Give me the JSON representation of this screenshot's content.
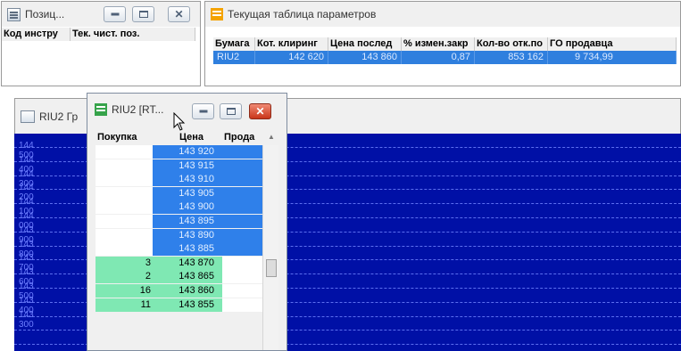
{
  "positions_window": {
    "title": "Позиц...",
    "columns": [
      "Код инстру",
      "Тек. чист. поз."
    ]
  },
  "params_window": {
    "title": "Текущая таблица параметров",
    "columns": [
      "Бумага",
      "Кот. клиринг",
      "Цена послед",
      "% измен.закр",
      "Кол-во отк.по",
      "ГО продавца"
    ],
    "rows": [
      [
        "RIU2",
        "142 620",
        "143 860",
        "0,87",
        "853 162",
        "9 734,99"
      ]
    ]
  },
  "chart_window": {
    "title": "RIU2 Гр",
    "y_labels": [
      "144 500",
      "144 400",
      "144 300",
      "144 200",
      "144 100",
      "144 000",
      "143 900",
      "143 800",
      "143 700",
      "143 600",
      "143 500",
      "143 400",
      "143 300"
    ]
  },
  "orderbook_window": {
    "title": "RIU2 [RT...",
    "columns": [
      "Покупка",
      "Цена",
      "Прода"
    ],
    "scroll_up_glyph": "▲",
    "rows": [
      {
        "bid": "",
        "price": "143 920",
        "type": "ask"
      },
      {
        "bid": "",
        "price": "143 915",
        "type": "ask"
      },
      {
        "bid": "",
        "price": "143 910",
        "type": "ask"
      },
      {
        "bid": "",
        "price": "143 905",
        "type": "ask"
      },
      {
        "bid": "",
        "price": "143 900",
        "type": "ask"
      },
      {
        "bid": "",
        "price": "143 895",
        "type": "ask"
      },
      {
        "bid": "",
        "price": "143 890",
        "type": "ask"
      },
      {
        "bid": "",
        "price": "143 885",
        "type": "ask"
      },
      {
        "bid": "3",
        "price": "143 870",
        "type": "bid"
      },
      {
        "bid": "2",
        "price": "143 865",
        "type": "bid"
      },
      {
        "bid": "16",
        "price": "143 860",
        "type": "bid"
      },
      {
        "bid": "11",
        "price": "143 855",
        "type": "bid"
      }
    ]
  },
  "colors": {
    "chart_background": "#0010a6",
    "ask_blue": "#2f80ea",
    "bid_green": "#7fe8b3",
    "close_red": "#c9361a"
  }
}
